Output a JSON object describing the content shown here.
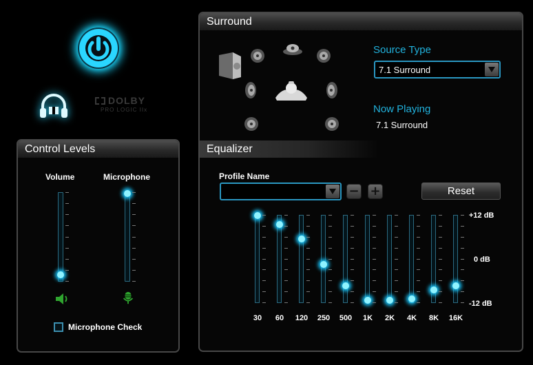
{
  "toolbar": {
    "power_icon": "power-icon",
    "headphone_icon": "headphone-dolby-icon",
    "dolby_logo": {
      "brand": "DOLBY",
      "subtitle": "PRO LOGIC IIx"
    },
    "accent_color": "#1ad8ff"
  },
  "control_levels": {
    "title": "Control Levels",
    "volume_label": "Volume",
    "microphone_label": "Microphone",
    "volume_level": 0.07,
    "microphone_level": 0.99,
    "volume_icon": "speaker-icon",
    "microphone_icon": "microphone-icon",
    "mic_check_label": "Microphone Check",
    "mic_check_checked": false
  },
  "surround": {
    "title": "Surround",
    "source_type_label": "Source Type",
    "source_type_value": "7.1 Surround",
    "now_playing_label": "Now Playing",
    "now_playing_value": "7.1 Surround",
    "speaker_icons": [
      "subwoofer-icon",
      "front-left-speaker-icon",
      "center-speaker-icon",
      "front-right-speaker-icon",
      "side-left-speaker-icon",
      "listener-icon",
      "side-right-speaker-icon",
      "rear-left-speaker-icon",
      "rear-right-speaker-icon"
    ]
  },
  "equalizer": {
    "title": "Equalizer",
    "profile_label": "Profile Name",
    "profile_value": "",
    "minus_label": "−",
    "plus_label": "+",
    "reset_label": "Reset",
    "db_top": "+12 dB",
    "db_mid": "0 dB",
    "db_bottom": "-12 dB",
    "bands": [
      {
        "freq": "30",
        "gain_db": 12.0
      },
      {
        "freq": "60",
        "gain_db": 9.5
      },
      {
        "freq": "120",
        "gain_db": 5.5
      },
      {
        "freq": "250",
        "gain_db": -1.5
      },
      {
        "freq": "500",
        "gain_db": -7.5
      },
      {
        "freq": "1K",
        "gain_db": -11.5
      },
      {
        "freq": "2K",
        "gain_db": -11.5
      },
      {
        "freq": "4K",
        "gain_db": -11.0
      },
      {
        "freq": "8K",
        "gain_db": -8.5
      },
      {
        "freq": "16K",
        "gain_db": -7.5
      }
    ]
  }
}
